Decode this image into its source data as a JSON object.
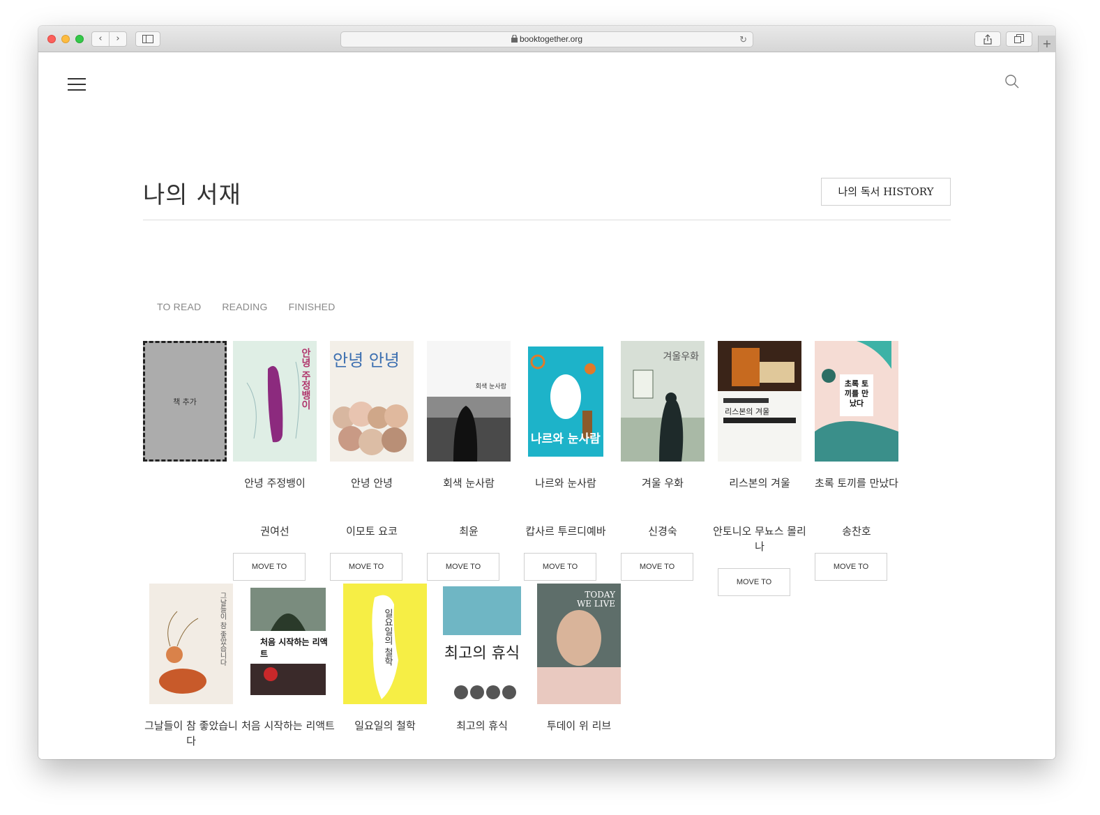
{
  "browser": {
    "url": "booktogether.org",
    "back_icon": "‹",
    "forward_icon": "›",
    "reload_icon": "↻",
    "new_tab_icon": "+"
  },
  "header": {
    "page_title": "나의 서재",
    "history_button": "나의 독서 HISTORY"
  },
  "tabs": [
    "TO READ",
    "READING",
    "FINISHED"
  ],
  "add_book_label": "책 추가",
  "move_button_label": "MOVE TO",
  "books": [
    {
      "title": "안녕 주정뱅이",
      "author": "권여선",
      "cover_text": "안녕 주정뱅이"
    },
    {
      "title": "안녕 안녕",
      "author": "이모토 요코",
      "cover_text": "안녕 안녕"
    },
    {
      "title": "회색 눈사람",
      "author": "최윤",
      "cover_text": "회색 눈사람"
    },
    {
      "title": "나르와 눈사람",
      "author": "캅사르 투르디예바",
      "cover_text": "나르와 눈사람"
    },
    {
      "title": "겨울 우화",
      "author": "신경숙",
      "cover_text": "겨울우화"
    },
    {
      "title": "리스본의 겨울",
      "author": "안토니오 무뇨스 몰리나",
      "cover_text": "리스본의 겨울"
    },
    {
      "title": "초록 토끼를 만났다",
      "author": "송찬호",
      "cover_text": "초록 토끼를 만났다"
    },
    {
      "title": "그날들이 참 좋았습니다",
      "cover_text": "그날들이 참 좋았습니다"
    },
    {
      "title": "처음 시작하는 리액트",
      "cover_text": "처음 시작하는 리액트"
    },
    {
      "title": "일요일의 철학",
      "cover_text": "일요일의 철학"
    },
    {
      "title": "최고의 휴식",
      "cover_text": "최고의 휴식"
    },
    {
      "title": "투데이 위 리브",
      "cover_text": "TODAY WE LIVE"
    }
  ],
  "colors": {
    "add_book_bg": "#acacac",
    "text": "#333333",
    "tab_text": "#888888"
  }
}
